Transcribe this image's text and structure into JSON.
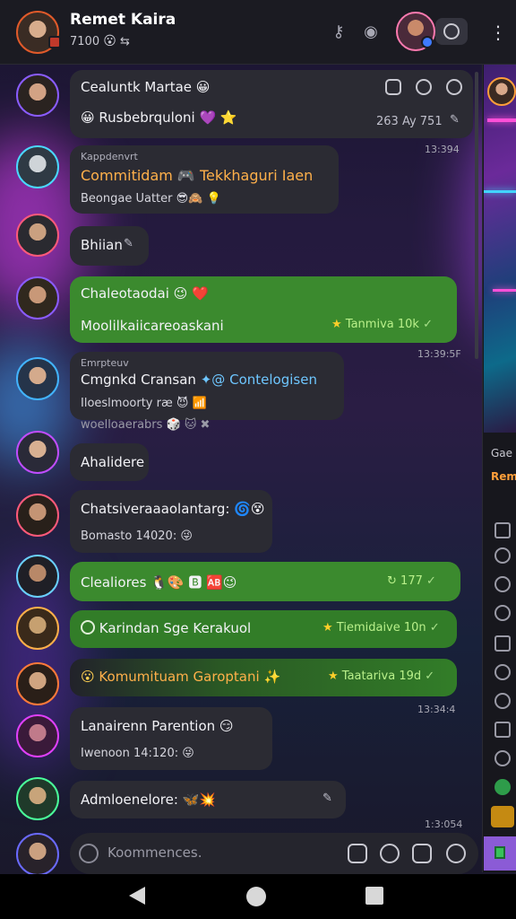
{
  "header": {
    "title": "Remet Kaira",
    "status_text": "7100",
    "status_emoji": "😮",
    "status_extra": "⇆",
    "icons": [
      "key-icon",
      "status-dot-icon",
      "settings-toggle-icon",
      "more-vert-icon"
    ]
  },
  "messages": [
    {
      "line1": "Cealuntk Martae 😀",
      "line2": "😀 Rusbebrquloni 💜 ⭐",
      "meta": "263 Ay 751",
      "ts_below": "13:394"
    },
    {
      "label": "Kappdenvrt",
      "line1": "Commitidam 🎮 Tekkhaguri Iaen",
      "line2": "Beongae Uatter 😎🙈 💡"
    },
    {
      "line1": "Bhiian"
    },
    {
      "line1": "Chaleotaodai 😉 ❤️",
      "line2": "Moolilkaiicareoaskani",
      "meta": "Tanmiva 10k",
      "ts_below": "13:39:5F"
    },
    {
      "label": "Emrpteuv",
      "line1": "Cmgnkd Cransan",
      "line1_blue": "Contelogisen",
      "line2": "Iloeslmoorty ræ 😈 📶",
      "line3": "woelloaerabrs 🎲 🐱 ✖"
    },
    {
      "line1": "Ahalidere"
    },
    {
      "line1": "Chatsiveraaaolantarg: 🌀😵",
      "line2": "Bomasto 14020: 😜"
    },
    {
      "line1": "Clealiores 🐧🎨 🅱 🆎😉",
      "meta": "177"
    },
    {
      "line1": "Karindan Sge Kerakuol",
      "meta": "Tiemidaive 10n"
    },
    {
      "line1": "Komumituam Garoptani",
      "meta": "Taatariva 19d",
      "ts_below": "13:34:4"
    },
    {
      "line1": "Lanairenn Parention 😏",
      "line2": "Iwenoon 14:120: 😜"
    },
    {
      "line1": "Admloenelore: 🦋💥",
      "ts_below": "1:3:054"
    }
  ],
  "composer": {
    "placeholder": "Koommences."
  },
  "right_panel": {
    "label1": "Gae",
    "label2": "Rem"
  },
  "colors": {
    "outgoing_bubble": "#3b8a2e",
    "incoming_bubble": "#2b2b33",
    "header_bg": "#1b1b22",
    "accent_purple": "#8b5bd6"
  }
}
